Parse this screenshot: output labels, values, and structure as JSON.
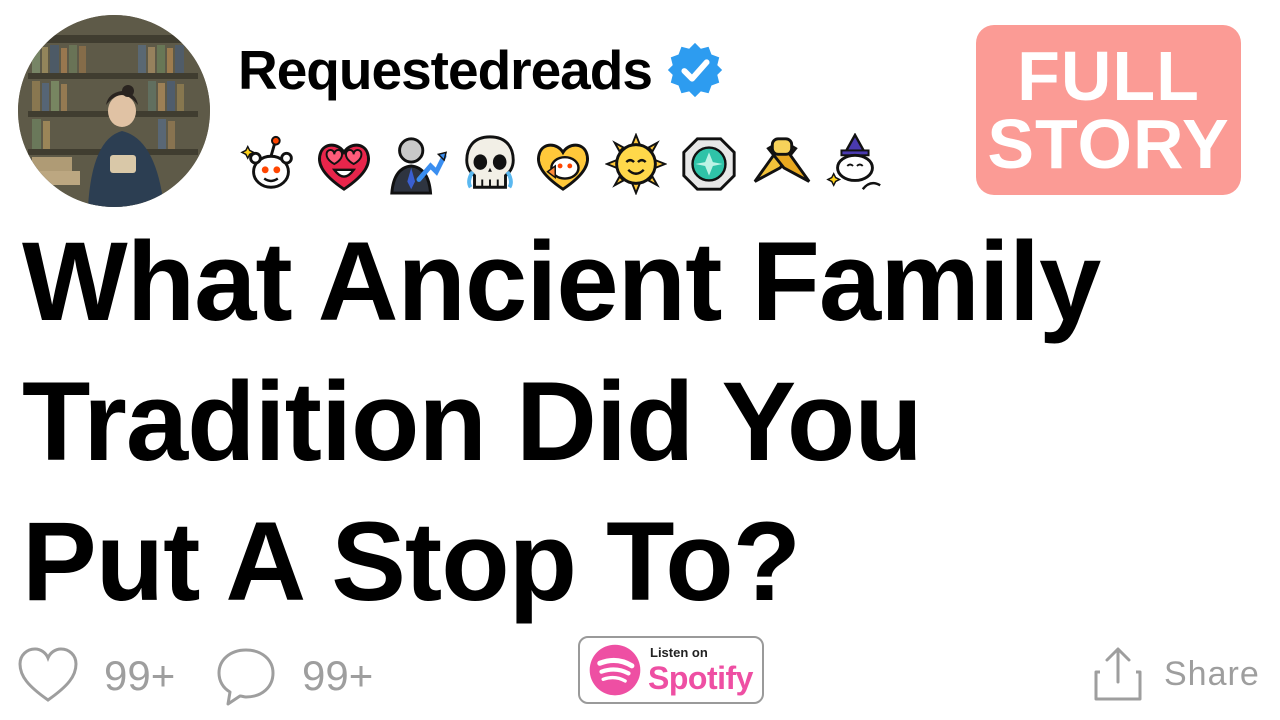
{
  "header": {
    "username": "Requestedreads",
    "verified_icon": "verified-check-icon",
    "awards": [
      "snoo-sparkle-award",
      "heart-eyes-award",
      "stonks-award",
      "crying-skull-award",
      "heart-snoo-award",
      "sun-face-award",
      "gem-award",
      "handshake-award",
      "wizard-snoo-award"
    ]
  },
  "badge": {
    "line1": "FULL",
    "line2": "STORY",
    "color": "#fb9b95"
  },
  "headline": {
    "line1": "What Ancient Family",
    "line2": "Tradition Did You",
    "line3": "Put A Stop To?"
  },
  "footer": {
    "likes_count": "99+",
    "comments_count": "99+",
    "spotify_small": "Listen on",
    "spotify_brand": "Spotify",
    "spotify_color": "#ee4fa3",
    "share_label": "Share"
  }
}
